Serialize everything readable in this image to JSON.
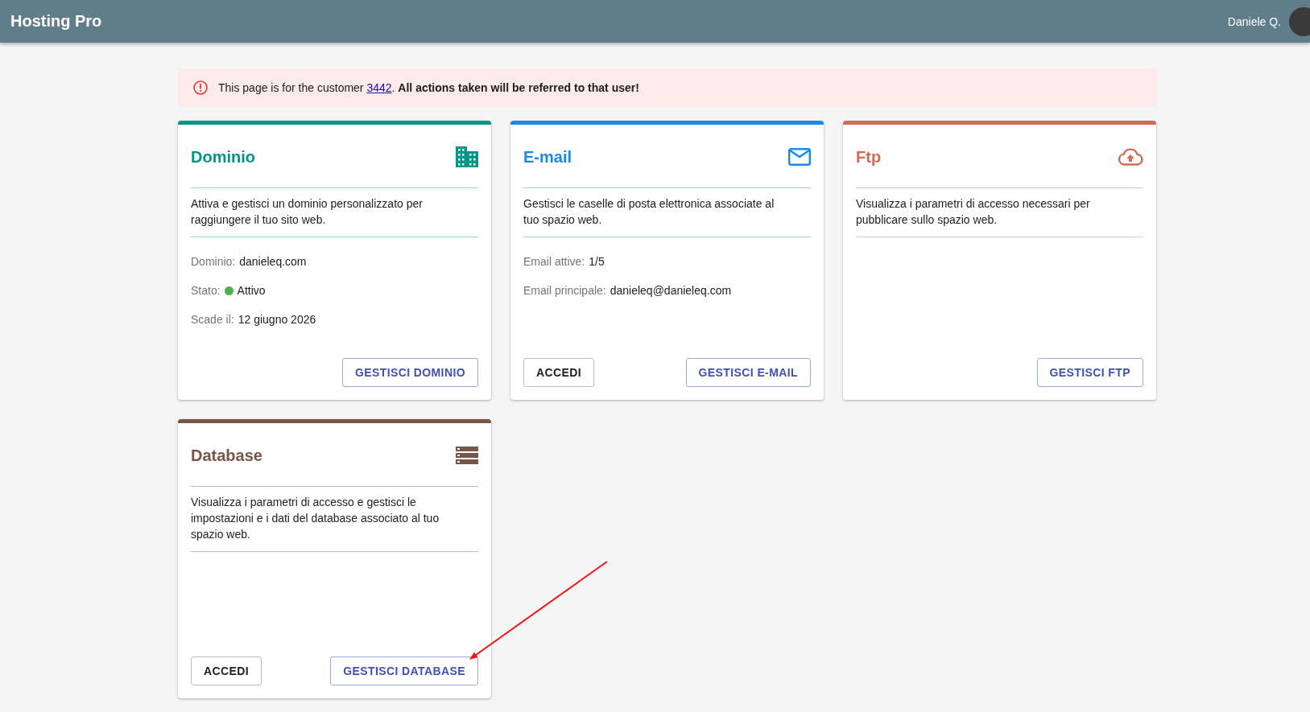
{
  "header": {
    "title": "Hosting Pro",
    "user": "Daniele Q."
  },
  "alert": {
    "before": "This page is for the customer ",
    "link": "3442",
    "after": ". **All actions taken will be referred to that user!**"
  },
  "cards": [
    {
      "title": "Dominio",
      "color": "#009688",
      "description": "Attiva e gestisci un dominio personalizzato per raggiungere il tuo sito web.",
      "fields": [
        {
          "label": "Dominio:",
          "value": "danieleq.com"
        },
        {
          "label": "Stato:",
          "value": "Attivo",
          "color": "#4caf50"
        },
        {
          "label": "Scade il:",
          "value": "12 giugno 2026"
        }
      ],
      "buttons": [
        {
          "label": "GESTISCI DOMINIO",
          "kind": "primary"
        }
      ]
    },
    {
      "title": "E-mail",
      "color": "#1e88e5",
      "description": "Gestisci le caselle di posta elettronica associate al tuo spazio web.",
      "fields": [
        {
          "label": "Email attive:",
          "value": "1/5"
        },
        {
          "label": "Email principale:",
          "value": "danieleq@danieleq.com"
        }
      ],
      "buttons": [
        {
          "label": "ACCEDI",
          "kind": "plain"
        },
        {
          "label": "GESTISCI E-MAIL",
          "kind": "primary"
        }
      ]
    },
    {
      "title": "Ftp",
      "color": "#d06b54",
      "description": "Visualizza i parametri di accesso necessari per pubblicare sullo spazio web.",
      "buttons": [
        {
          "label": "GESTISCI FTP",
          "kind": "primary"
        }
      ]
    },
    {
      "title": "Database",
      "color": "#795548",
      "description": "Visualizza i parametri di accesso e gestisci le impostazioni e i dati del database associato al tuo spazio web.",
      "buttons": [
        {
          "label": "ACCEDI",
          "kind": "plain"
        },
        {
          "label": "GESTISCI DATABASE",
          "kind": "primary"
        }
      ]
    }
  ]
}
